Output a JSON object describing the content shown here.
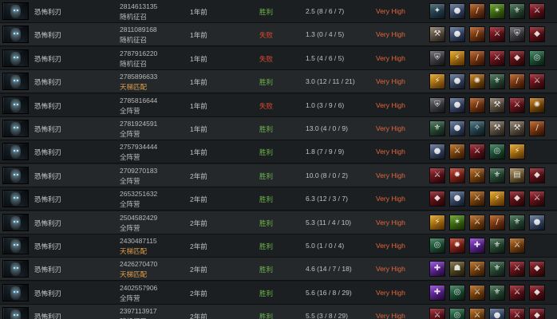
{
  "items_legend": {
    "skull-basher-icon": {
      "glyph": "✦",
      "from": "#3b5b6a",
      "to": "#0f2330"
    },
    "orb-icon": {
      "glyph": "●",
      "from": "#5a6f93",
      "to": "#162036"
    },
    "blade-icon": {
      "glyph": "/",
      "from": "#b35a1c",
      "to": "#3a1405"
    },
    "wraith-icon": {
      "glyph": "✶",
      "from": "#5c9a1c",
      "to": "#1e3806"
    },
    "butterfly-icon": {
      "glyph": "⚜",
      "from": "#3f6d4f",
      "to": "#0f2217"
    },
    "claw-icon": {
      "glyph": "⚔",
      "from": "#9b1f2a",
      "to": "#2a0508"
    },
    "axe-icon": {
      "glyph": "⚒",
      "from": "#8a7a66",
      "to": "#2a241c"
    },
    "satanic-icon": {
      "glyph": "◆",
      "from": "#8e1b24",
      "to": "#2c0508"
    },
    "yasha-icon": {
      "glyph": "⚡",
      "from": "#e0a11c",
      "to": "#6b3b05"
    },
    "blink-icon": {
      "glyph": "✧",
      "from": "#3f6a7a",
      "to": "#0d1d23"
    },
    "rune-icon": {
      "glyph": "✺",
      "from": "#c57a14",
      "to": "#3a1f02"
    },
    "helm-icon": {
      "glyph": "⛨",
      "from": "#5f5f66",
      "to": "#1a1a1e"
    },
    "sword-icon": {
      "glyph": "⚔",
      "from": "#b56818",
      "to": "#3a1c04"
    },
    "scroll-icon": {
      "glyph": "▤",
      "from": "#a88c5a",
      "to": "#3a2b12"
    },
    "ring-icon": {
      "glyph": "◎",
      "from": "#2f7a55",
      "to": "#0a2416"
    },
    "relic-icon": {
      "glyph": "✹",
      "from": "#c13a2a",
      "to": "#3a0a06"
    },
    "staff-icon": {
      "glyph": "✚",
      "from": "#8c3fd6",
      "to": "#2a0a46"
    },
    "mask-icon": {
      "glyph": "☗",
      "from": "#7a6a3a",
      "to": "#261f0c"
    }
  },
  "rows": [
    {
      "hero": "恐怖利刃",
      "match_id": "2814613135",
      "lobby": "随机征召",
      "ranked": false,
      "date": "1年前",
      "result": "胜利",
      "win": true,
      "kda": "2.5 (8 / 6 / 7)",
      "skill": "Very High",
      "items": [
        "skull-basher-icon",
        "orb-icon",
        "blade-icon",
        "wraith-icon",
        "butterfly-icon",
        "claw-icon"
      ]
    },
    {
      "hero": "恐怖利刃",
      "match_id": "2811089168",
      "lobby": "随机征召",
      "ranked": false,
      "date": "1年前",
      "result": "失败",
      "win": false,
      "kda": "1.3 (0 / 4 / 5)",
      "skill": "Very High",
      "items": [
        "axe-icon",
        "orb-icon",
        "blade-icon",
        "claw-icon",
        "helm-icon",
        "satanic-icon"
      ]
    },
    {
      "hero": "恐怖利刃",
      "match_id": "2787916220",
      "lobby": "随机征召",
      "ranked": false,
      "date": "1年前",
      "result": "失败",
      "win": false,
      "kda": "1.5 (4 / 6 / 5)",
      "skill": "Very High",
      "items": [
        "helm-icon",
        "yasha-icon",
        "blade-icon",
        "claw-icon",
        "satanic-icon",
        "ring-icon"
      ]
    },
    {
      "hero": "恐怖利刃",
      "match_id": "2785896633",
      "lobby": "天梯匹配",
      "ranked": true,
      "date": "1年前",
      "result": "胜利",
      "win": true,
      "kda": "3.0 (12 / 11 / 21)",
      "skill": "Very High",
      "items": [
        "yasha-icon",
        "orb-icon",
        "rune-icon",
        "butterfly-icon",
        "blade-icon",
        "claw-icon"
      ]
    },
    {
      "hero": "恐怖利刃",
      "match_id": "2785816644",
      "lobby": "全阵营",
      "ranked": false,
      "date": "1年前",
      "result": "失败",
      "win": false,
      "kda": "1.0 (3 / 9 / 6)",
      "skill": "Very High",
      "items": [
        "helm-icon",
        "orb-icon",
        "blade-icon",
        "axe-icon",
        "claw-icon",
        "rune-icon"
      ]
    },
    {
      "hero": "恐怖利刃",
      "match_id": "2781924591",
      "lobby": "全阵营",
      "ranked": false,
      "date": "1年前",
      "result": "胜利",
      "win": true,
      "kda": "13.0 (4 / 0 / 9)",
      "skill": "Very High",
      "items": [
        "butterfly-icon",
        "orb-icon",
        "blink-icon",
        "axe-icon",
        "axe-icon",
        "blade-icon"
      ]
    },
    {
      "hero": "恐怖利刃",
      "match_id": "2757934444",
      "lobby": "全阵营",
      "ranked": false,
      "date": "1年前",
      "result": "胜利",
      "win": true,
      "kda": "1.8 (7 / 9 / 9)",
      "skill": "Very High",
      "items": [
        "orb-icon",
        "sword-icon",
        "claw-icon",
        "ring-icon",
        "yasha-icon"
      ]
    },
    {
      "hero": "恐怖利刃",
      "match_id": "2709270183",
      "lobby": "全阵营",
      "ranked": false,
      "date": "2年前",
      "result": "胜利",
      "win": true,
      "kda": "10.0 (8 / 0 / 2)",
      "skill": "Very High",
      "items": [
        "claw-icon",
        "relic-icon",
        "sword-icon",
        "butterfly-icon",
        "scroll-icon",
        "satanic-icon"
      ]
    },
    {
      "hero": "恐怖利刃",
      "match_id": "2653251632",
      "lobby": "全阵营",
      "ranked": false,
      "date": "2年前",
      "result": "胜利",
      "win": true,
      "kda": "6.3 (12 / 3 / 7)",
      "skill": "Very High",
      "items": [
        "satanic-icon",
        "orb-icon",
        "sword-icon",
        "yasha-icon",
        "satanic-icon",
        "claw-icon"
      ]
    },
    {
      "hero": "恐怖利刃",
      "match_id": "2504582429",
      "lobby": "全阵营",
      "ranked": false,
      "date": "2年前",
      "result": "胜利",
      "win": true,
      "kda": "5.3 (11 / 4 / 10)",
      "skill": "Very High",
      "items": [
        "yasha-icon",
        "wraith-icon",
        "sword-icon",
        "blade-icon",
        "butterfly-icon",
        "orb-icon"
      ]
    },
    {
      "hero": "恐怖利刃",
      "match_id": "2430487115",
      "lobby": "天梯匹配",
      "ranked": true,
      "date": "2年前",
      "result": "胜利",
      "win": true,
      "kda": "5.0 (1 / 0 / 4)",
      "skill": "Very High",
      "items": [
        "ring-icon",
        "relic-icon",
        "staff-icon",
        "butterfly-icon",
        "sword-icon"
      ]
    },
    {
      "hero": "恐怖利刃",
      "match_id": "2426270470",
      "lobby": "天梯匹配",
      "ranked": true,
      "date": "2年前",
      "result": "胜利",
      "win": true,
      "kda": "4.6 (14 / 7 / 18)",
      "skill": "Very High",
      "items": [
        "staff-icon",
        "mask-icon",
        "sword-icon",
        "butterfly-icon",
        "claw-icon",
        "satanic-icon"
      ]
    },
    {
      "hero": "恐怖利刃",
      "match_id": "2402557906",
      "lobby": "全阵营",
      "ranked": false,
      "date": "2年前",
      "result": "胜利",
      "win": true,
      "kda": "5.6 (16 / 8 / 29)",
      "skill": "Very High",
      "items": [
        "staff-icon",
        "ring-icon",
        "sword-icon",
        "butterfly-icon",
        "claw-icon",
        "satanic-icon"
      ]
    },
    {
      "hero": "恐怖利刃",
      "match_id": "2397113917",
      "lobby": "随机征召",
      "ranked": false,
      "date": "2年前",
      "result": "胜利",
      "win": true,
      "kda": "5.5 (3 / 8 / 29)",
      "skill": "Very High",
      "items": [
        "claw-icon",
        "ring-icon",
        "sword-icon",
        "orb-icon",
        "claw-icon",
        "satanic-icon"
      ]
    }
  ]
}
